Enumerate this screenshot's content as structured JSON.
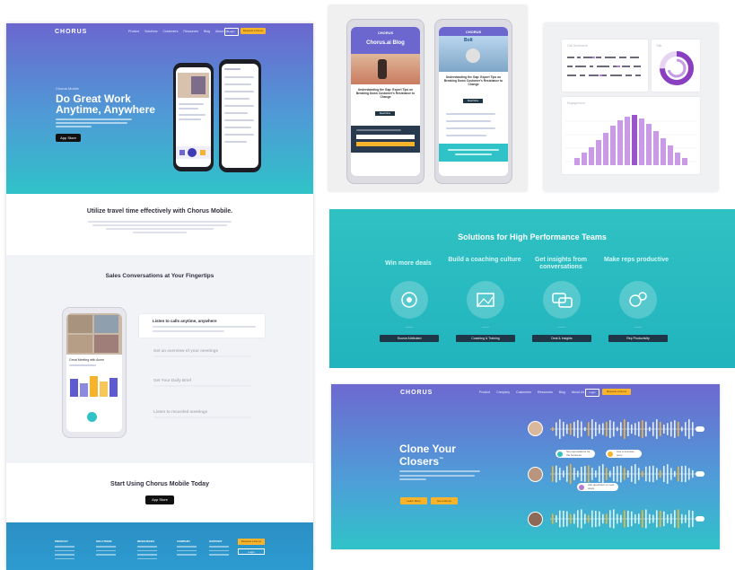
{
  "colors": {
    "hero_gradient_top": "#6b67cf",
    "hero_gradient_bottom": "#2fc3c8",
    "accent_yellow": "#f7b32b",
    "teal": "#21b4be",
    "dark_navy": "#1f3647",
    "chart_purple": "#b57ad6"
  },
  "mobile_page": {
    "logo": "CHORUS",
    "nav": {
      "links": [
        "Product",
        "Solutions",
        "Customers",
        "Resources",
        "Blog",
        "About Us"
      ],
      "login": "Login",
      "cta": "Request a Demo"
    },
    "hero": {
      "eyebrow": "Chorus Mobile",
      "title": "Do Great Work Anytime, Anywhere",
      "store_badge": "App Store"
    },
    "section_travel": {
      "title": "Utilize travel time effectively with Chorus Mobile."
    },
    "section_conversations": {
      "title": "Sales Conversations at Your Fingertips",
      "features": [
        {
          "label": "Listen to calls anytime, anywhere"
        },
        {
          "label": "Get an overview of your meetings"
        },
        {
          "label": "Get Your Daily Brief"
        },
        {
          "label": "Listen to recorded meetings"
        }
      ],
      "phone_card": "Great Meeting with Acme"
    },
    "section_start": {
      "title": "Start Using Chorus Mobile Today",
      "store_badge": "App Store"
    },
    "footer": {
      "columns": [
        "PRODUCT",
        "SOLUTIONS",
        "RESOURCES",
        "COMPANY",
        "SUPPORT"
      ],
      "cta": "Request a Demo",
      "login": "Login"
    }
  },
  "blog_panel": {
    "phone1": {
      "logo": "CHORUS",
      "title": "Chorus.ai Blog",
      "post_title": "Understanding the Gap: Expert Tips on Breaking Down Customer's Resistance to Change",
      "button": "Read More"
    },
    "phone2": {
      "logo": "CHORUS",
      "badge": "Bolt",
      "post_title": "Understanding the Gap: Expert Tips on Breaking Down Customer's Resistance to Change",
      "button": "Read More"
    }
  },
  "dashboard_panel": {
    "card_labels": [
      "Call Sentiment",
      "Talk",
      "Engagement"
    ]
  },
  "solutions": {
    "title": "Solutions for High Performance Teams",
    "items": [
      {
        "heading": "Win more deals",
        "button": "Source Attributed",
        "icon": "target-icon"
      },
      {
        "heading": "Build a coaching culture",
        "button": "Coaching & Training",
        "icon": "image-icon"
      },
      {
        "heading": "Get insights from conversations",
        "button": "Deal & Insights",
        "icon": "chat-icon"
      },
      {
        "heading": "Make reps productive",
        "button": "Rep Productivity",
        "icon": "gear-icon"
      }
    ]
  },
  "clone_hero": {
    "logo": "CHORUS",
    "nav": {
      "links": [
        "Product",
        "Company",
        "Customers",
        "Resources",
        "Blog",
        "About Us"
      ],
      "login": "Login",
      "cta": "Request a Demo"
    },
    "title_line1": "Clone Your",
    "title_line2": "Closers",
    "trademark": "™",
    "buttons": [
      "Learn More",
      "Get a Demo"
    ],
    "bubbles": [
      "Set expectations for the business",
      "Use a success story",
      "Ask questions on next steps"
    ]
  }
}
